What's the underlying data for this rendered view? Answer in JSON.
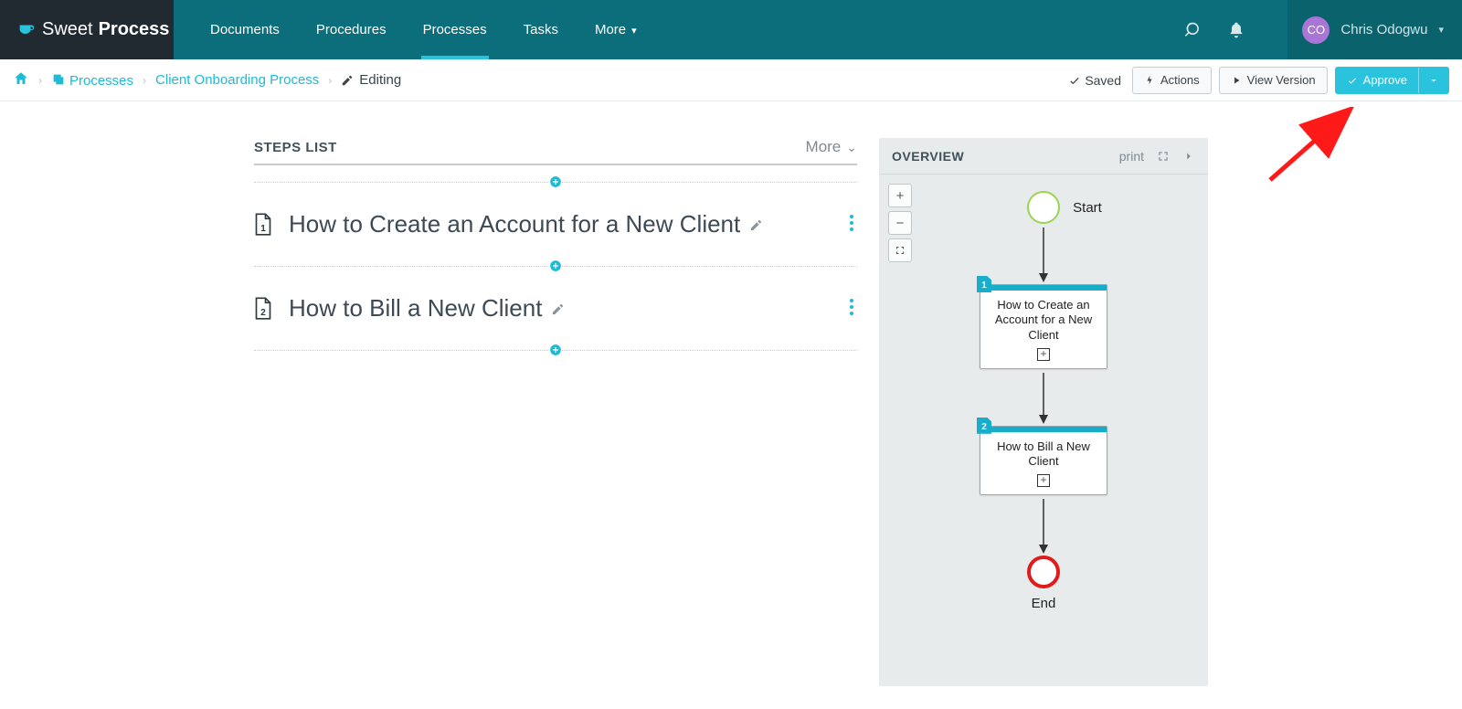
{
  "brand": {
    "light": "Sweet",
    "heavy": "Process"
  },
  "nav": {
    "items": [
      "Documents",
      "Procedures",
      "Processes",
      "Tasks",
      "More"
    ],
    "activeIndex": 2
  },
  "user": {
    "initials": "CO",
    "name": "Chris Odogwu"
  },
  "breadcrumb": {
    "section": "Processes",
    "item": "Client Onboarding Process",
    "state": "Editing"
  },
  "toolbar": {
    "saved": "Saved",
    "actions": "Actions",
    "viewVersion": "View Version",
    "approve": "Approve"
  },
  "steps": {
    "heading": "STEPS LIST",
    "more": "More",
    "items": [
      {
        "num": "1",
        "title": "How to Create an Account for a New Client"
      },
      {
        "num": "2",
        "title": "How to Bill a New Client"
      }
    ]
  },
  "overview": {
    "heading": "OVERVIEW",
    "print": "print",
    "start": "Start",
    "end": "End",
    "nodes": [
      {
        "num": "1",
        "label": "How to Create an Account for a New Client"
      },
      {
        "num": "2",
        "label": "How to Bill a New Client"
      }
    ]
  }
}
